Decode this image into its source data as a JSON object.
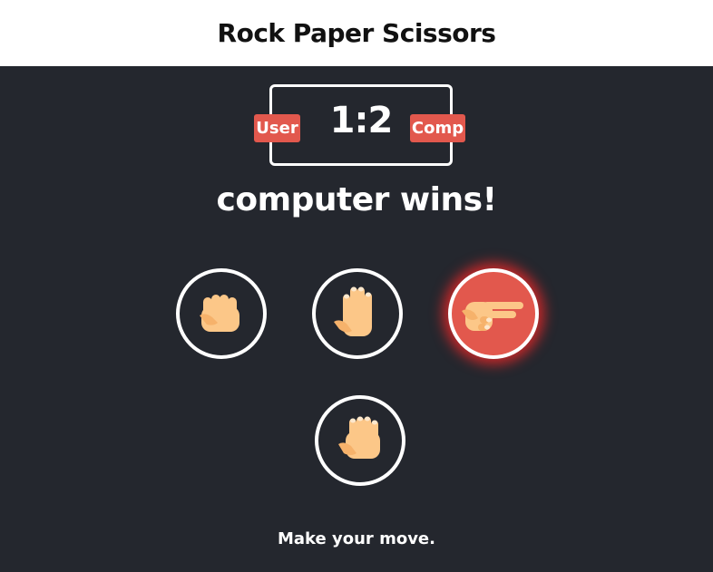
{
  "header": {
    "title": "Rock Paper Scissors"
  },
  "scoreboard": {
    "user_label": "User",
    "comp_label": "Comp",
    "user_score": 1,
    "comp_score": 2,
    "score_text": "1:2"
  },
  "result": {
    "text": "computer wins!"
  },
  "choices": [
    {
      "id": "rock",
      "icon": "rock-hand-icon",
      "selected": false
    },
    {
      "id": "paper",
      "icon": "paper-hand-icon",
      "selected": false
    },
    {
      "id": "scissors",
      "icon": "scissors-hand-icon",
      "selected": true
    }
  ],
  "computer_choice": {
    "icon": "rock-hand-icon"
  },
  "message": {
    "text": "Make your move."
  },
  "colors": {
    "background": "#24272e",
    "accent": "#e2584d",
    "skin": "#fcc788",
    "skin_shade": "#f6b26b"
  }
}
